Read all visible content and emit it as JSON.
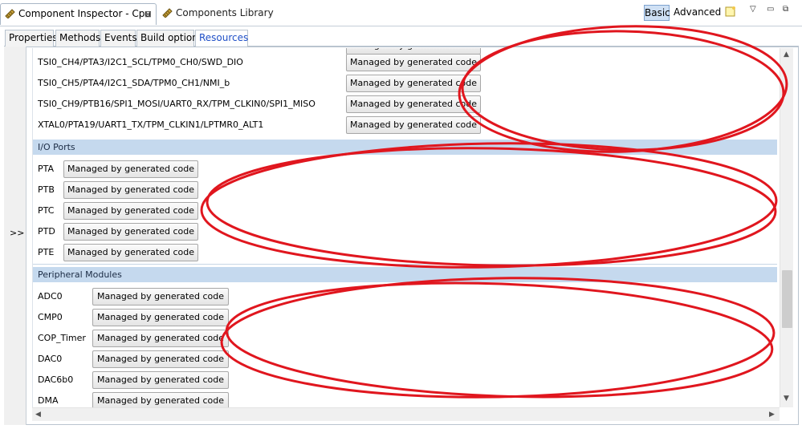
{
  "view_tabs": {
    "inspector": "Component Inspector - Cpu",
    "inspector_close": "⊠",
    "library": "Components Library"
  },
  "toolbar": {
    "basic": "Basic",
    "advanced": "Advanced",
    "menu_glyph": "▽",
    "minimize_glyph": "▭",
    "maximize_glyph": "⧉"
  },
  "sub_tabs": [
    "Properties",
    "Methods",
    "Events",
    "Build options",
    "Resources"
  ],
  "collapse_label": ">>",
  "button_text": "Managed by generated code",
  "pins": [
    "TSI0_CH4/PTA3/I2C1_SCL/TPM0_CH0/SWD_DIO",
    "TSI0_CH5/PTA4/I2C1_SDA/TPM0_CH1/NMI_b",
    "TSI0_CH9/PTB16/SPI1_MOSI/UART0_RX/TPM_CLKIN0/SPI1_MISO",
    "XTAL0/PTA19/UART1_TX/TPM_CLKIN1/LPTMR0_ALT1"
  ],
  "io_ports": {
    "title": "I/O Ports",
    "items": [
      "PTA",
      "PTB",
      "PTC",
      "PTD",
      "PTE"
    ]
  },
  "peripheral_modules": {
    "title": "Peripheral Modules",
    "items": [
      "ADC0",
      "CMP0",
      "COP_Timer",
      "DAC0",
      "DAC6b0",
      "DMA"
    ]
  },
  "colors": {
    "annotation": "#e0161e",
    "section_header": "#c5d9ee",
    "active_tab_text": "#1f4fc7"
  }
}
